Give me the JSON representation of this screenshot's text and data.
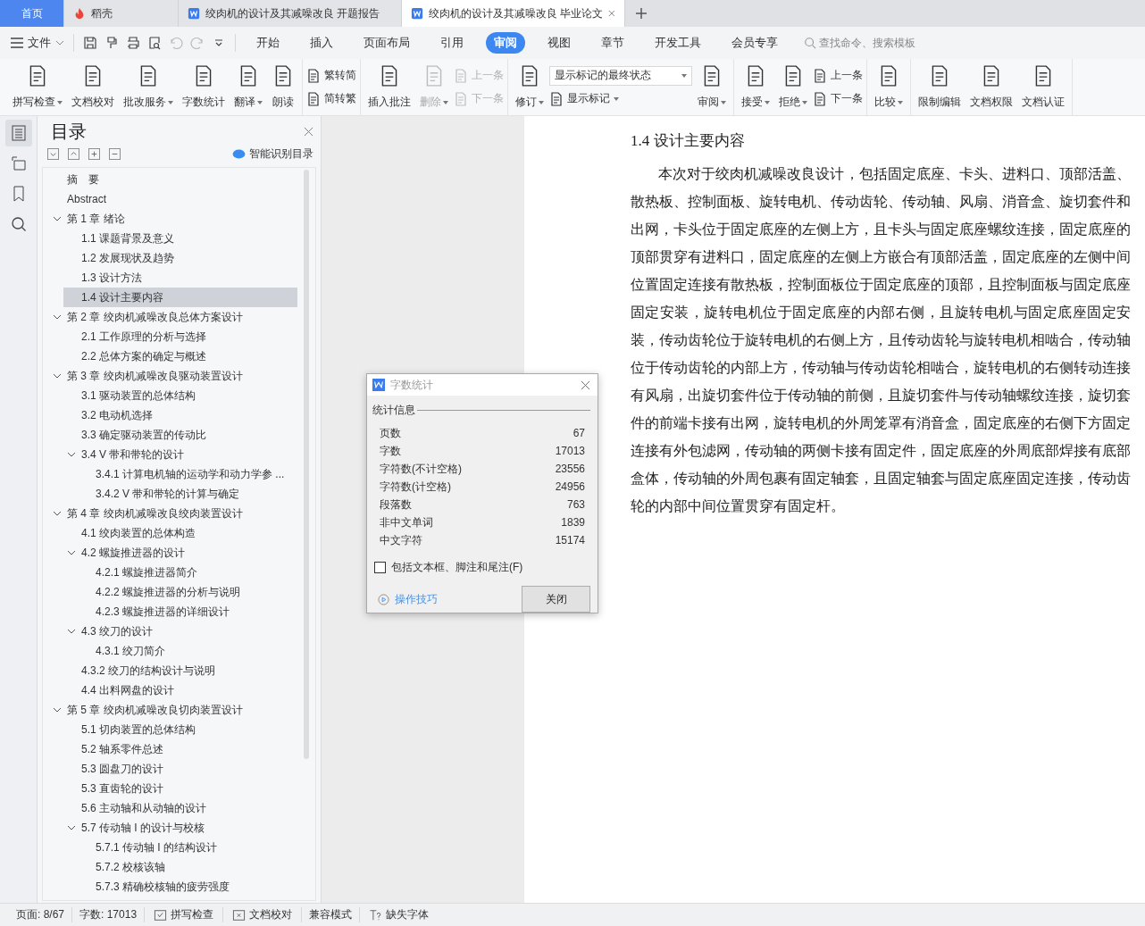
{
  "title_tabs": [
    {
      "label": "首页",
      "kind": "home",
      "selected": false
    },
    {
      "label": "稻壳",
      "kind": "app",
      "selected": false
    },
    {
      "label": "绞肉机的设计及其减噪改良 开题报告",
      "kind": "doc",
      "selected": false
    },
    {
      "label": "绞肉机的设计及其减噪改良 毕业论文",
      "kind": "doc",
      "selected": true
    }
  ],
  "menu": {
    "file_label": "文件",
    "quick_actions": [
      {
        "kind": "save",
        "disabled": false
      },
      {
        "kind": "painter",
        "disabled": false
      },
      {
        "kind": "print",
        "disabled": false
      },
      {
        "kind": "preview",
        "disabled": false
      },
      {
        "kind": "undo",
        "disabled": true
      },
      {
        "kind": "redo",
        "disabled": true
      }
    ],
    "tabs": [
      {
        "label": "开始",
        "selected": false
      },
      {
        "label": "插入",
        "selected": false
      },
      {
        "label": "页面布局",
        "selected": false
      },
      {
        "label": "引用",
        "selected": false
      },
      {
        "label": "审阅",
        "selected": true
      },
      {
        "label": "视图",
        "selected": false
      },
      {
        "label": "章节",
        "selected": false
      },
      {
        "label": "开发工具",
        "selected": false
      },
      {
        "label": "会员专享",
        "selected": false
      }
    ],
    "search": {
      "placeholder": "查找命令、搜索模板"
    }
  },
  "ribbon": {
    "groups": [
      {
        "items": [
          {
            "kind": "large",
            "label": "拼写检查",
            "dropdown": true,
            "disabled": false
          },
          {
            "kind": "large",
            "label": "文档校对",
            "dropdown": false,
            "disabled": false
          },
          {
            "kind": "large",
            "label": "批改服务",
            "dropdown": true,
            "disabled": false
          },
          {
            "kind": "large",
            "label": "字数统计",
            "dropdown": false,
            "disabled": false
          },
          {
            "kind": "large",
            "label": "翻译",
            "dropdown": true,
            "disabled": false
          },
          {
            "kind": "large",
            "label": "朗读",
            "dropdown": false,
            "disabled": false
          }
        ]
      },
      {
        "items": [
          {
            "kind": "stack",
            "items": [
              {
                "kind": "small",
                "label": "繁转简",
                "dropdown": false,
                "disabled": false
              },
              {
                "kind": "small",
                "label": "简转繁",
                "dropdown": false,
                "disabled": false
              }
            ]
          }
        ]
      },
      {
        "items": [
          {
            "kind": "large",
            "label": "插入批注",
            "dropdown": false,
            "disabled": false
          },
          {
            "kind": "large",
            "label": "删除",
            "dropdown": true,
            "disabled": true
          },
          {
            "kind": "stack",
            "items": [
              {
                "kind": "small",
                "label": "上一条",
                "dropdown": false,
                "disabled": true
              },
              {
                "kind": "small",
                "label": "下一条",
                "dropdown": false,
                "disabled": true
              }
            ]
          }
        ]
      },
      {
        "items": [
          {
            "kind": "large",
            "label": "修订",
            "dropdown": true,
            "disabled": false
          },
          {
            "kind": "stack",
            "items": [
              {
                "kind": "select",
                "label": "显示标记的最终状态",
                "dropdown": true
              },
              {
                "kind": "small",
                "label": "显示标记",
                "dropdown": true,
                "disabled": false
              }
            ]
          },
          {
            "kind": "large",
            "label": "审阅",
            "dropdown": true,
            "disabled": false
          }
        ]
      },
      {
        "items": [
          {
            "kind": "large",
            "label": "接受",
            "dropdown": true,
            "disabled": false
          },
          {
            "kind": "large",
            "label": "拒绝",
            "dropdown": true,
            "disabled": false
          },
          {
            "kind": "stack",
            "items": [
              {
                "kind": "small",
                "label": "上一条",
                "dropdown": false,
                "disabled": false
              },
              {
                "kind": "small",
                "label": "下一条",
                "dropdown": false,
                "disabled": false
              }
            ]
          }
        ]
      },
      {
        "items": [
          {
            "kind": "large",
            "label": "比较",
            "dropdown": true,
            "disabled": false
          }
        ]
      },
      {
        "items": [
          {
            "kind": "large",
            "label": "限制编辑",
            "dropdown": false,
            "disabled": false
          },
          {
            "kind": "large",
            "label": "文档权限",
            "dropdown": false,
            "disabled": false
          },
          {
            "kind": "large",
            "label": "文档认证",
            "dropdown": false,
            "disabled": false
          }
        ]
      }
    ]
  },
  "sidebar": {
    "items": [
      {
        "kind": "toc",
        "selected": true
      },
      {
        "kind": "navigation",
        "selected": false
      },
      {
        "kind": "bookmark",
        "selected": false
      },
      {
        "kind": "search",
        "selected": false
      }
    ]
  },
  "toc": {
    "title": "目录",
    "smart_button": "智能识别目录",
    "items": [
      {
        "label": "摘　要",
        "selected": false
      },
      {
        "label": "Abstract",
        "selected": false
      },
      {
        "label": "第 1 章  绪论",
        "selected": false,
        "expanded": true,
        "children": [
          {
            "label": "1.1 课题背景及意义",
            "selected": false
          },
          {
            "label": "1.2 发展现状及趋势",
            "selected": false
          },
          {
            "label": "1.3 设计方法",
            "selected": false
          },
          {
            "label": "1.4 设计主要内容",
            "selected": true
          }
        ]
      },
      {
        "label": "第 2 章  绞肉机减噪改良总体方案设计",
        "selected": false,
        "expanded": true,
        "children": [
          {
            "label": "2.1  工作原理的分析与选择",
            "selected": false
          },
          {
            "label": "2.2  总体方案的确定与概述",
            "selected": false
          }
        ]
      },
      {
        "label": "第 3 章  绞肉机减噪改良驱动装置设计",
        "selected": false,
        "expanded": true,
        "children": [
          {
            "label": "3.1 驱动装置的总体结构",
            "selected": false
          },
          {
            "label": "3.2  电动机选择",
            "selected": false
          },
          {
            "label": "3.3 确定驱动装置的传动比",
            "selected": false
          },
          {
            "label": "3.4 V 带和带轮的设计",
            "selected": false,
            "expanded": true,
            "children": [
              {
                "label": "3.4.1  计算电机轴的运动学和动力学参 ...",
                "selected": false
              },
              {
                "label": "3.4.2 V 带和带轮的计算与确定",
                "selected": false
              }
            ]
          }
        ]
      },
      {
        "label": "第 4 章  绞肉机减噪改良绞肉装置设计",
        "selected": false,
        "expanded": true,
        "children": [
          {
            "label": "4.1 绞肉装置的总体构造",
            "selected": false
          },
          {
            "label": "4.2  螺旋推进器的设计",
            "selected": false,
            "expanded": true,
            "children": [
              {
                "label": "4.2.1 螺旋推进器简介",
                "selected": false
              },
              {
                "label": "4.2.2 螺旋推进器的分析与说明",
                "selected": false
              },
              {
                "label": "4.2.3 螺旋推进器的详细设计",
                "selected": false
              }
            ]
          },
          {
            "label": "4.3 绞刀的设计",
            "selected": false,
            "expanded": true,
            "children": [
              {
                "label": "4.3.1 绞刀简介",
                "selected": false
              }
            ]
          },
          {
            "label": "4.3.2 绞刀的结构设计与说明",
            "selected": false
          },
          {
            "label": "4.4 出料网盘的设计",
            "selected": false
          }
        ]
      },
      {
        "label": "第 5 章  绞肉机减噪改良切肉装置设计",
        "selected": false,
        "expanded": true,
        "children": [
          {
            "label": "5.1 切肉装置的总体结构",
            "selected": false
          },
          {
            "label": "5.2 轴系零件总述",
            "selected": false
          },
          {
            "label": "5.3 圆盘刀的设计",
            "selected": false
          },
          {
            "label": "5.3 直齿轮的设计",
            "selected": false
          },
          {
            "label": "5.6 主动轴和从动轴的设计",
            "selected": false
          },
          {
            "label": "5.7 传动轴 I 的设计与校核",
            "selected": false,
            "expanded": true,
            "children": [
              {
                "label": "5.7.1 传动轴 I 的结构设计",
                "selected": false
              },
              {
                "label": "5.7.2 校核该轴",
                "selected": false
              },
              {
                "label": "5.7.3  精确校核轴的疲劳强度",
                "selected": false
              }
            ]
          }
        ]
      }
    ]
  },
  "document": {
    "heading": "1.4 设计主要内容",
    "paragraphs": [
      "本次对于绞肉机减噪改良设计，包括固定底座、卡头、进料口、顶部活盖、散热板、控制面板、旋转电机、传动齿轮、传动轴、风扇、消音盒、旋切套件和出网，卡头位于固定底座的左侧上方，且卡头与固定底座螺纹连接，固定底座的顶部贯穿有进料口，固定底座的左侧上方嵌合有顶部活盖，固定底座的左侧中间位置固定连接有散热板，控制面板位于固定底座的顶部，且控制面板与固定底座固定安装，旋转电机位于固定底座的内部右侧，且旋转电机与固定底座固定安装，传动齿轮位于旋转电机的右侧上方，且传动齿轮与旋转电机相啮合，传动轴位于传动齿轮的内部上方，传动轴与传动齿轮相啮合，旋转电机的右侧转动连接有风扇，出旋切套件位于传动轴的前侧，且旋切套件与传动轴螺纹连接，旋切套件的前端卡接有出网，旋转电机的外周笼罩有消音盒，固定底座的右侧下方固定连接有外包滤网，传动轴的两侧卡接有固定件，固定底座的外周底部焊接有底部盒体，传动轴的外周包裹有固定轴套，且固定轴套与固定底座固定连接，传动齿轮的内部中间位置贯穿有固定杆。"
    ]
  },
  "dialog": {
    "title": "字数统计",
    "section": "统计信息",
    "rows": [
      {
        "label": "页数",
        "value": "67"
      },
      {
        "label": "字数",
        "value": "17013"
      },
      {
        "label": "字符数(不计空格)",
        "value": "23556"
      },
      {
        "label": "字符数(计空格)",
        "value": "24956"
      },
      {
        "label": "段落数",
        "value": "763"
      },
      {
        "label": "非中文单词",
        "value": "1839"
      },
      {
        "label": "中文字符",
        "value": "15174"
      }
    ],
    "checkbox": {
      "label": "包括文本框、脚注和尾注(F)",
      "checked": false
    },
    "tips_link": "操作技巧",
    "close_button": "关闭"
  },
  "status_bar": {
    "items": [
      {
        "label": "页面: 8/67",
        "kind": "text"
      },
      {
        "label": "字数: 17013",
        "kind": "text"
      },
      {
        "label": "拼写检查",
        "kind": "spell"
      },
      {
        "label": "文档校对",
        "kind": "proof"
      },
      {
        "label": "兼容模式",
        "kind": "text"
      },
      {
        "label": "缺失字体",
        "kind": "font"
      }
    ]
  }
}
